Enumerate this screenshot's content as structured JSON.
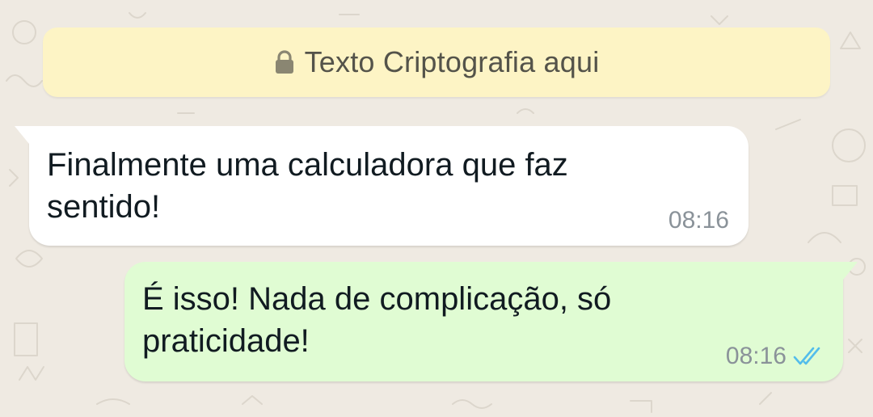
{
  "banner": {
    "text": "Texto Criptografia aqui",
    "icon": "lock-icon"
  },
  "messages": [
    {
      "direction": "incoming",
      "text": "Finalmente uma calculadora que faz sentido!",
      "time": "08:16"
    },
    {
      "direction": "outgoing",
      "text": "É isso! Nada de complicação, só praticidade!",
      "time": "08:16",
      "status_icon": "double-check-read-icon"
    }
  ],
  "colors": {
    "background": "#efeae2",
    "banner": "#fdf4c5",
    "incoming_bubble": "#ffffff",
    "outgoing_bubble": "#e0fcd3",
    "read_ticks": "#53bdeb"
  }
}
